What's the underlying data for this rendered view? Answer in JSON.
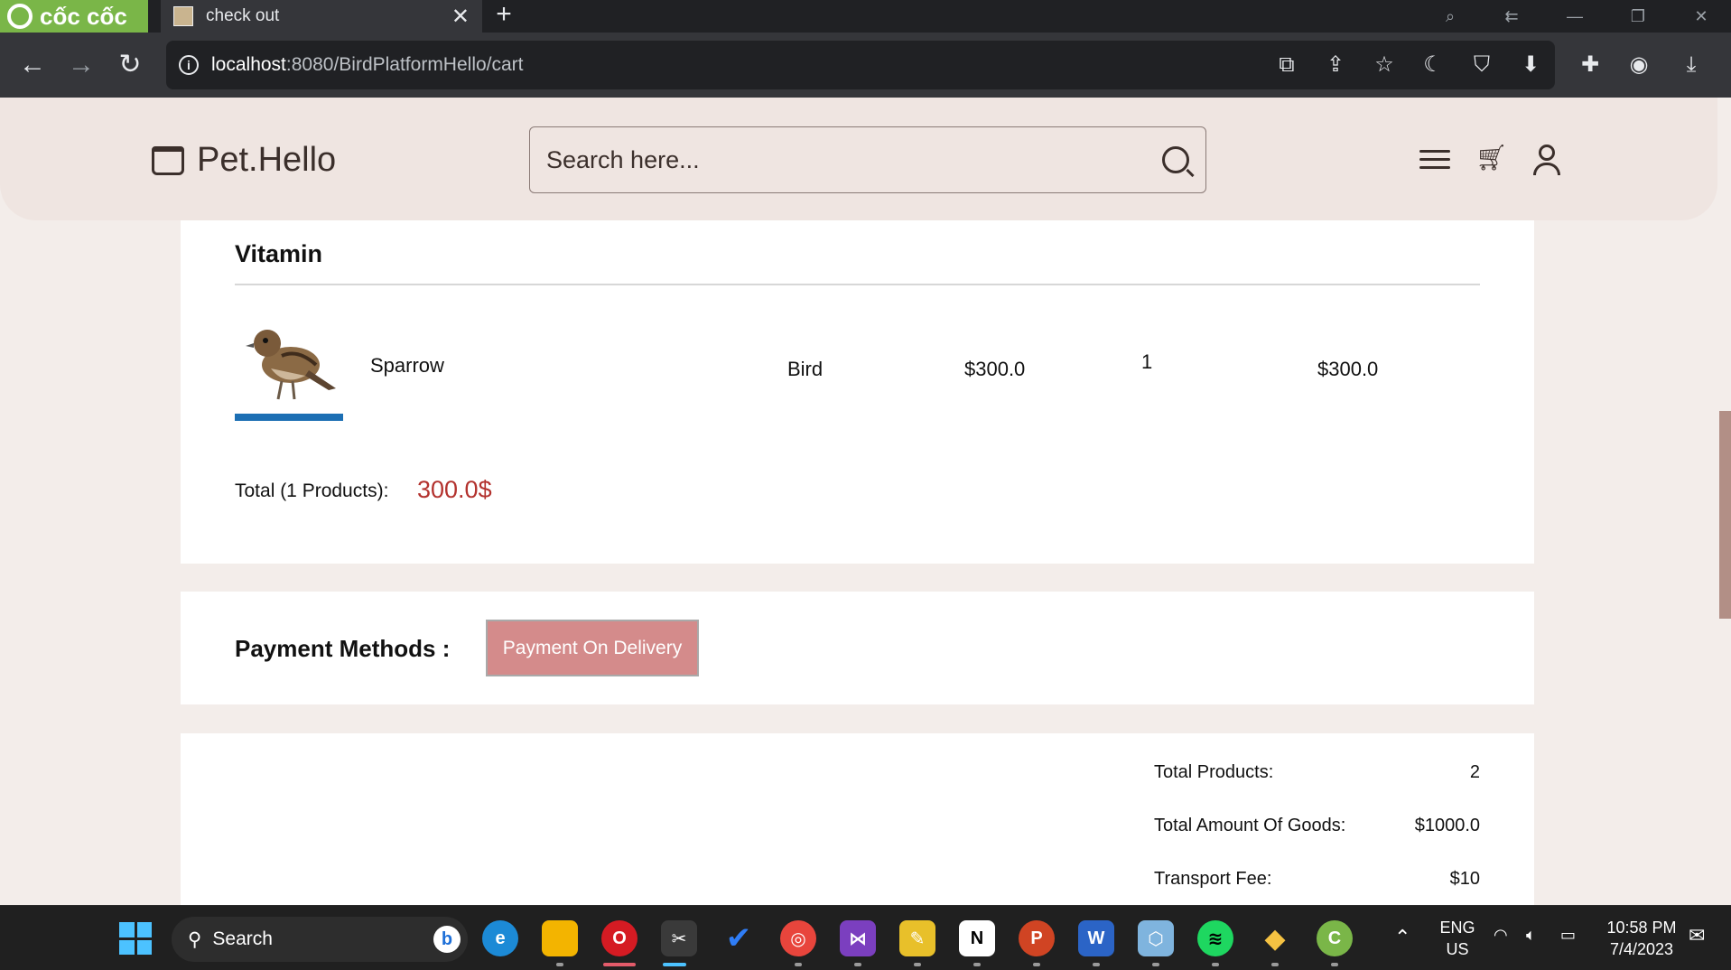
{
  "browser": {
    "brand": "cốc cốc",
    "tab_title": "check out",
    "url_host": "localhost",
    "url_path": ":8080/BirdPlatformHello/cart"
  },
  "header": {
    "logo_text": "Pet.Hello",
    "search_placeholder": "Search here..."
  },
  "cart": {
    "category": "Vitamin",
    "items": [
      {
        "name": "Sparrow",
        "type": "Bird",
        "price": "$300.0",
        "quantity": "1",
        "subtotal": "$300.0"
      }
    ],
    "total_label": "Total (1 Products):",
    "total_value": "300.0$"
  },
  "payment": {
    "label": "Payment Methods :",
    "method_button": "Payment On Delivery"
  },
  "summary": {
    "rows": [
      {
        "label": "Total Products:",
        "value": "2"
      },
      {
        "label": "Total Amount Of Goods:",
        "value": "$1000.0"
      },
      {
        "label": "Transport Fee:",
        "value": "$10"
      }
    ]
  },
  "taskbar": {
    "search_label": "Search",
    "lang_line1": "ENG",
    "lang_line2": "US",
    "time": "10:58 PM",
    "date": "7/4/2023"
  },
  "colors": {
    "accent_red": "#b3322e",
    "payment_button": "#d48b8b",
    "header_bg": "#efe5e1"
  }
}
